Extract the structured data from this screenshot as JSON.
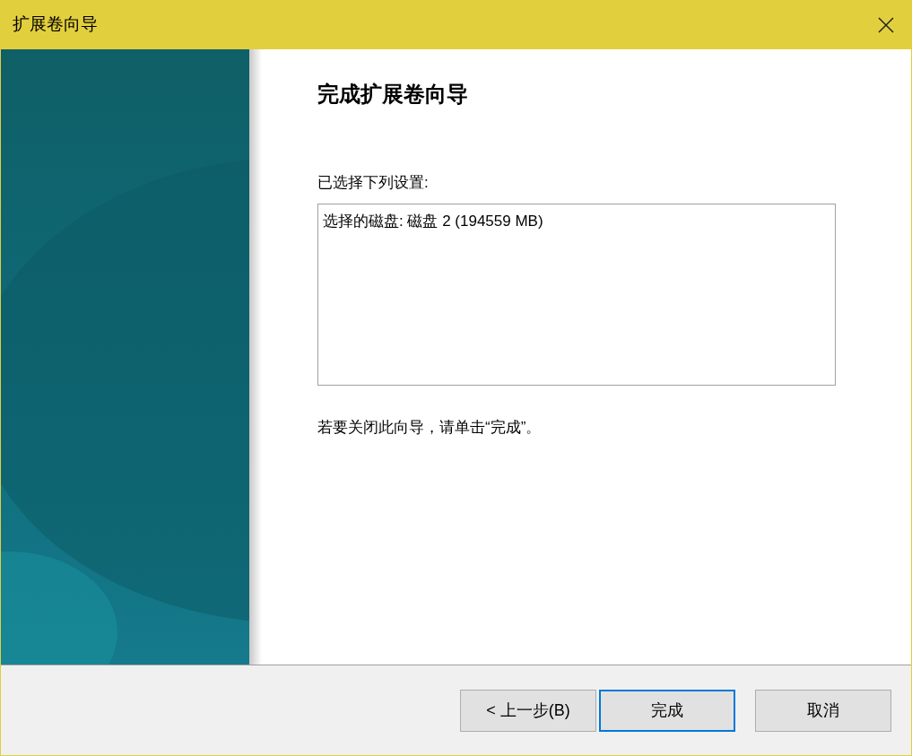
{
  "window": {
    "title": "扩展卷向导"
  },
  "heading": "完成扩展卷向导",
  "settings_label": "已选择下列设置:",
  "settings_text": "选择的磁盘: 磁盘 2 (194559 MB)",
  "hint": "若要关闭此向导，请单击“完成”。",
  "buttons": [
    {
      "label": "< 上一步(B)",
      "focused": false
    },
    {
      "label": "完成",
      "focused": true
    },
    {
      "label": "取消",
      "focused": false
    }
  ]
}
